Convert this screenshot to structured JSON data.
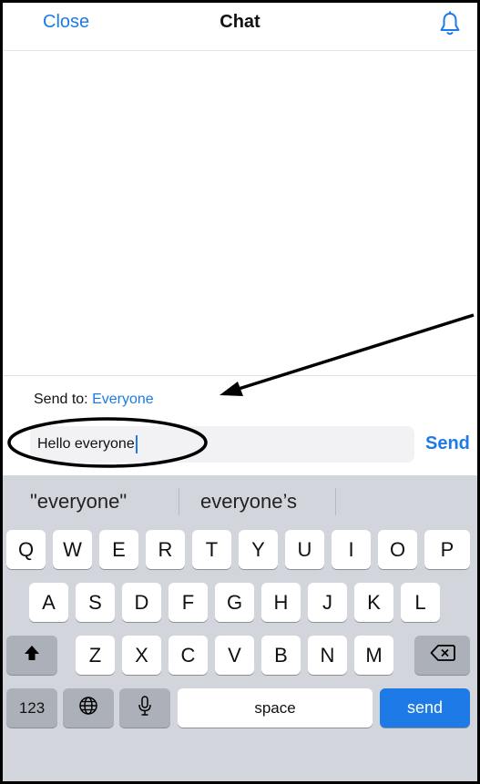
{
  "header": {
    "close_label": "Close",
    "title": "Chat",
    "notification_icon": "bell-icon"
  },
  "composer": {
    "send_to_label": "Send to:",
    "send_to_target": "Everyone",
    "input_value": "Hello everyone",
    "send_label": "Send"
  },
  "keyboard": {
    "suggestions": [
      "\"everyone\"",
      "everyone’s"
    ],
    "row1": [
      "Q",
      "W",
      "E",
      "R",
      "T",
      "Y",
      "U",
      "I",
      "O",
      "P"
    ],
    "row2": [
      "A",
      "S",
      "D",
      "F",
      "G",
      "H",
      "J",
      "K",
      "L"
    ],
    "row3": [
      "Z",
      "X",
      "C",
      "V",
      "B",
      "N",
      "M"
    ],
    "shift_icon": "shift-icon",
    "backspace_icon": "backspace-icon",
    "numbers_label": "123",
    "globe_icon": "globe-icon",
    "mic_icon": "microphone-icon",
    "space_label": "space",
    "send_label": "send"
  },
  "colors": {
    "accent": "#1e7ae6",
    "keyboard_bg": "#d2d5db",
    "key_bg": "#ffffff",
    "function_key_bg": "#acb1b9"
  }
}
